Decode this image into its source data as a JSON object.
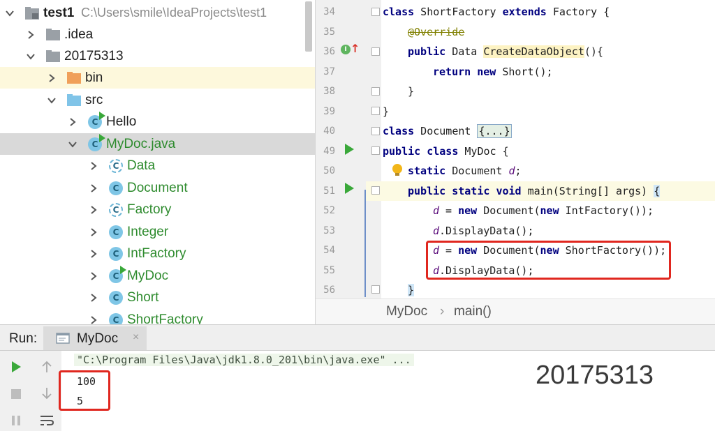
{
  "project": {
    "root_name": "test1",
    "root_path": "C:\\Users\\smile\\IdeaProjects\\test1",
    "items": [
      {
        "label": "test1",
        "kind": "root",
        "expanded": true
      },
      {
        "label": ".idea",
        "kind": "folder-gray",
        "expanded": false
      },
      {
        "label": "20175313",
        "kind": "folder-gray",
        "expanded": true
      },
      {
        "label": "bin",
        "kind": "folder-orange",
        "expanded": false
      },
      {
        "label": "src",
        "kind": "folder-blue",
        "expanded": true
      },
      {
        "label": "Hello",
        "kind": "class-run"
      },
      {
        "label": "MyDoc.java",
        "kind": "class-run",
        "expanded": true
      },
      {
        "label": "Data",
        "kind": "class-abstract"
      },
      {
        "label": "Document",
        "kind": "class"
      },
      {
        "label": "Factory",
        "kind": "class-abstract"
      },
      {
        "label": "Integer",
        "kind": "class"
      },
      {
        "label": "IntFactory",
        "kind": "class"
      },
      {
        "label": "MyDoc",
        "kind": "class-run"
      },
      {
        "label": "Short",
        "kind": "class"
      },
      {
        "label": "ShortFactory",
        "kind": "class"
      }
    ]
  },
  "editor": {
    "line_numbers": [
      "34",
      "35",
      "36",
      "37",
      "38",
      "39",
      "40",
      "49",
      "50",
      "51",
      "52",
      "53",
      "54",
      "55",
      "56"
    ],
    "lines": {
      "l34": {
        "kw1": "class",
        "t1": " ShortFactory ",
        "kw2": "extends",
        "t2": " Factory {"
      },
      "l35": {
        "anno": "@Override"
      },
      "l36": {
        "kw1": "public",
        "t1": " Data ",
        "fn": "CreateDataObject",
        "t2": "(){"
      },
      "l37": {
        "kw1": "return",
        "t1": " ",
        "kw2": "new",
        "t2": " Short();"
      },
      "l38": {
        "t1": "}"
      },
      "l39": {
        "t1": "}"
      },
      "l40": {
        "kw1": "class",
        "t1": " Document ",
        "fold": "{...}"
      },
      "l49": {
        "kw1": "public",
        "t1": " ",
        "kw2": "class",
        "t2": " MyDoc {"
      },
      "l50": {
        "kw1": "static",
        "t1": " Document ",
        "var": "d",
        "t2": ";"
      },
      "l51": {
        "kw1": "public",
        "t1": " ",
        "kw2": "static",
        "t2": " ",
        "kw3": "void",
        "t3": " main(String[] args) ",
        "brace": "{"
      },
      "l52": {
        "var": "d",
        "t1": " = ",
        "kw1": "new",
        "t2": " Document(",
        "kw2": "new",
        "t3": " IntFactory());"
      },
      "l53": {
        "var": "d",
        "t1": ".DisplayData();"
      },
      "l54": {
        "var": "d",
        "t1": " = ",
        "kw1": "new",
        "t2": " Document(",
        "kw2": "new",
        "t3": " ShortFactory());"
      },
      "l55": {
        "var": "d",
        "t1": ".DisplayData();"
      },
      "l56": {
        "brace": "}"
      }
    }
  },
  "breadcrumb": {
    "file": "MyDoc",
    "method": "main()",
    "separator": "›"
  },
  "run": {
    "label": "Run:",
    "tab": "MyDoc",
    "command": "\"C:\\Program Files\\Java\\jdk1.8.0_201\\bin\\java.exe\" ...",
    "output": [
      "100",
      "5"
    ]
  },
  "watermark": "20175313",
  "colors": {
    "highlight_box": "#e0271f",
    "run_green": "#3aa83a",
    "keyword": "#00007f"
  }
}
